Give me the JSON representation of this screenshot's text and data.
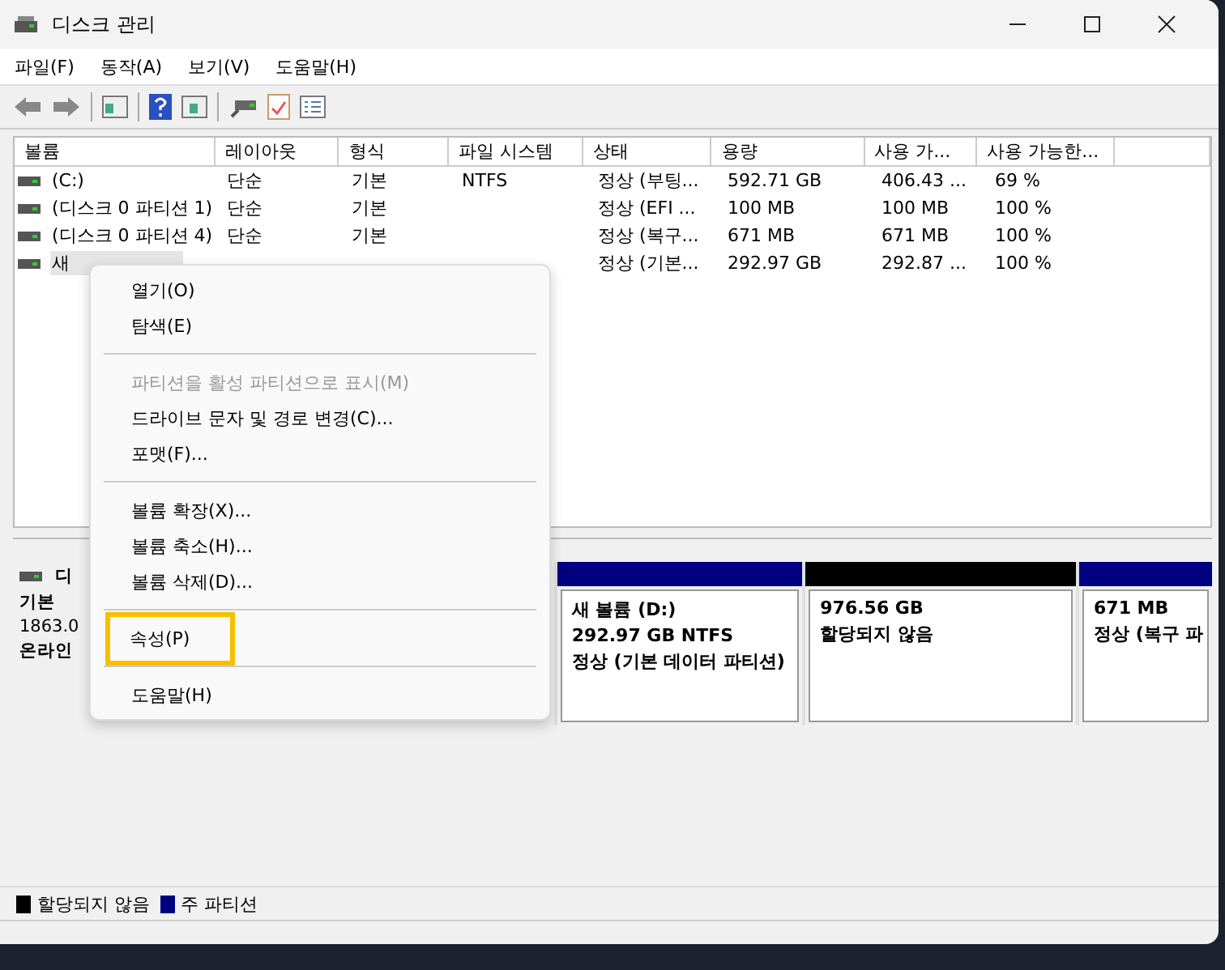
{
  "window": {
    "title": "디스크 관리"
  },
  "menu_bar": [
    "파일(F)",
    "동작(A)",
    "보기(V)",
    "도움말(H)"
  ],
  "volume_table": {
    "columns": [
      "볼륨",
      "레이아웃",
      "형식",
      "파일 시스템",
      "상태",
      "용량",
      "사용 가...",
      "사용 가능한...",
      ""
    ],
    "rows": [
      {
        "selected": false,
        "cells": [
          "(C:)",
          "단순",
          "기본",
          "NTFS",
          "정상 (부팅...",
          "592.71 GB",
          "406.43 ...",
          "69 %"
        ]
      },
      {
        "selected": false,
        "cells": [
          "(디스크 0 파티션 1)",
          "단순",
          "기본",
          "",
          "정상 (EFI ...",
          "100 MB",
          "100 MB",
          "100 %"
        ]
      },
      {
        "selected": false,
        "cells": [
          "(디스크 0 파티션 4)",
          "단순",
          "기본",
          "",
          "정상 (복구...",
          "671 MB",
          "671 MB",
          "100 %"
        ]
      },
      {
        "selected": true,
        "cells": [
          "새",
          "",
          "",
          "",
          "정상 (기본...",
          "292.97 GB",
          "292.87 ...",
          "100 %"
        ]
      }
    ]
  },
  "disk": {
    "name": "디",
    "type": "기본",
    "size": "1863.0",
    "status": "온라인",
    "partitions": [
      {
        "color": "#000080",
        "lines": [
          "새 볼륨  (D:)",
          "292.97 GB NTFS",
          "정상 (기본 데이터 파티션)"
        ]
      },
      {
        "color": "#000000",
        "lines": [
          "976.56 GB",
          "할당되지 않음"
        ]
      },
      {
        "color": "#000080",
        "lines": [
          "671 MB",
          "정상 (복구 파"
        ]
      }
    ]
  },
  "context_menu": [
    {
      "kind": "item",
      "label": "열기(O)",
      "disabled": false,
      "highlighted": false
    },
    {
      "kind": "item",
      "label": "탐색(E)",
      "disabled": false,
      "highlighted": false
    },
    {
      "kind": "separator"
    },
    {
      "kind": "item",
      "label": "파티션을 활성 파티션으로 표시(M)",
      "disabled": true,
      "highlighted": false
    },
    {
      "kind": "item",
      "label": "드라이브 문자 및 경로 변경(C)...",
      "disabled": false,
      "highlighted": false
    },
    {
      "kind": "item",
      "label": "포맷(F)...",
      "disabled": false,
      "highlighted": false
    },
    {
      "kind": "separator"
    },
    {
      "kind": "item",
      "label": "볼륨 확장(X)...",
      "disabled": false,
      "highlighted": false
    },
    {
      "kind": "item",
      "label": "볼륨 축소(H)...",
      "disabled": false,
      "highlighted": false
    },
    {
      "kind": "item",
      "label": "볼륨 삭제(D)...",
      "disabled": false,
      "highlighted": false
    },
    {
      "kind": "separator"
    },
    {
      "kind": "item",
      "label": "속성(P)",
      "disabled": false,
      "highlighted": true
    },
    {
      "kind": "separator"
    },
    {
      "kind": "item",
      "label": "도움말(H)",
      "disabled": false,
      "highlighted": false
    }
  ],
  "legend": [
    {
      "label": "할당되지 않음",
      "color": "#000000"
    },
    {
      "label": "주 파티션",
      "color": "#000080"
    }
  ]
}
